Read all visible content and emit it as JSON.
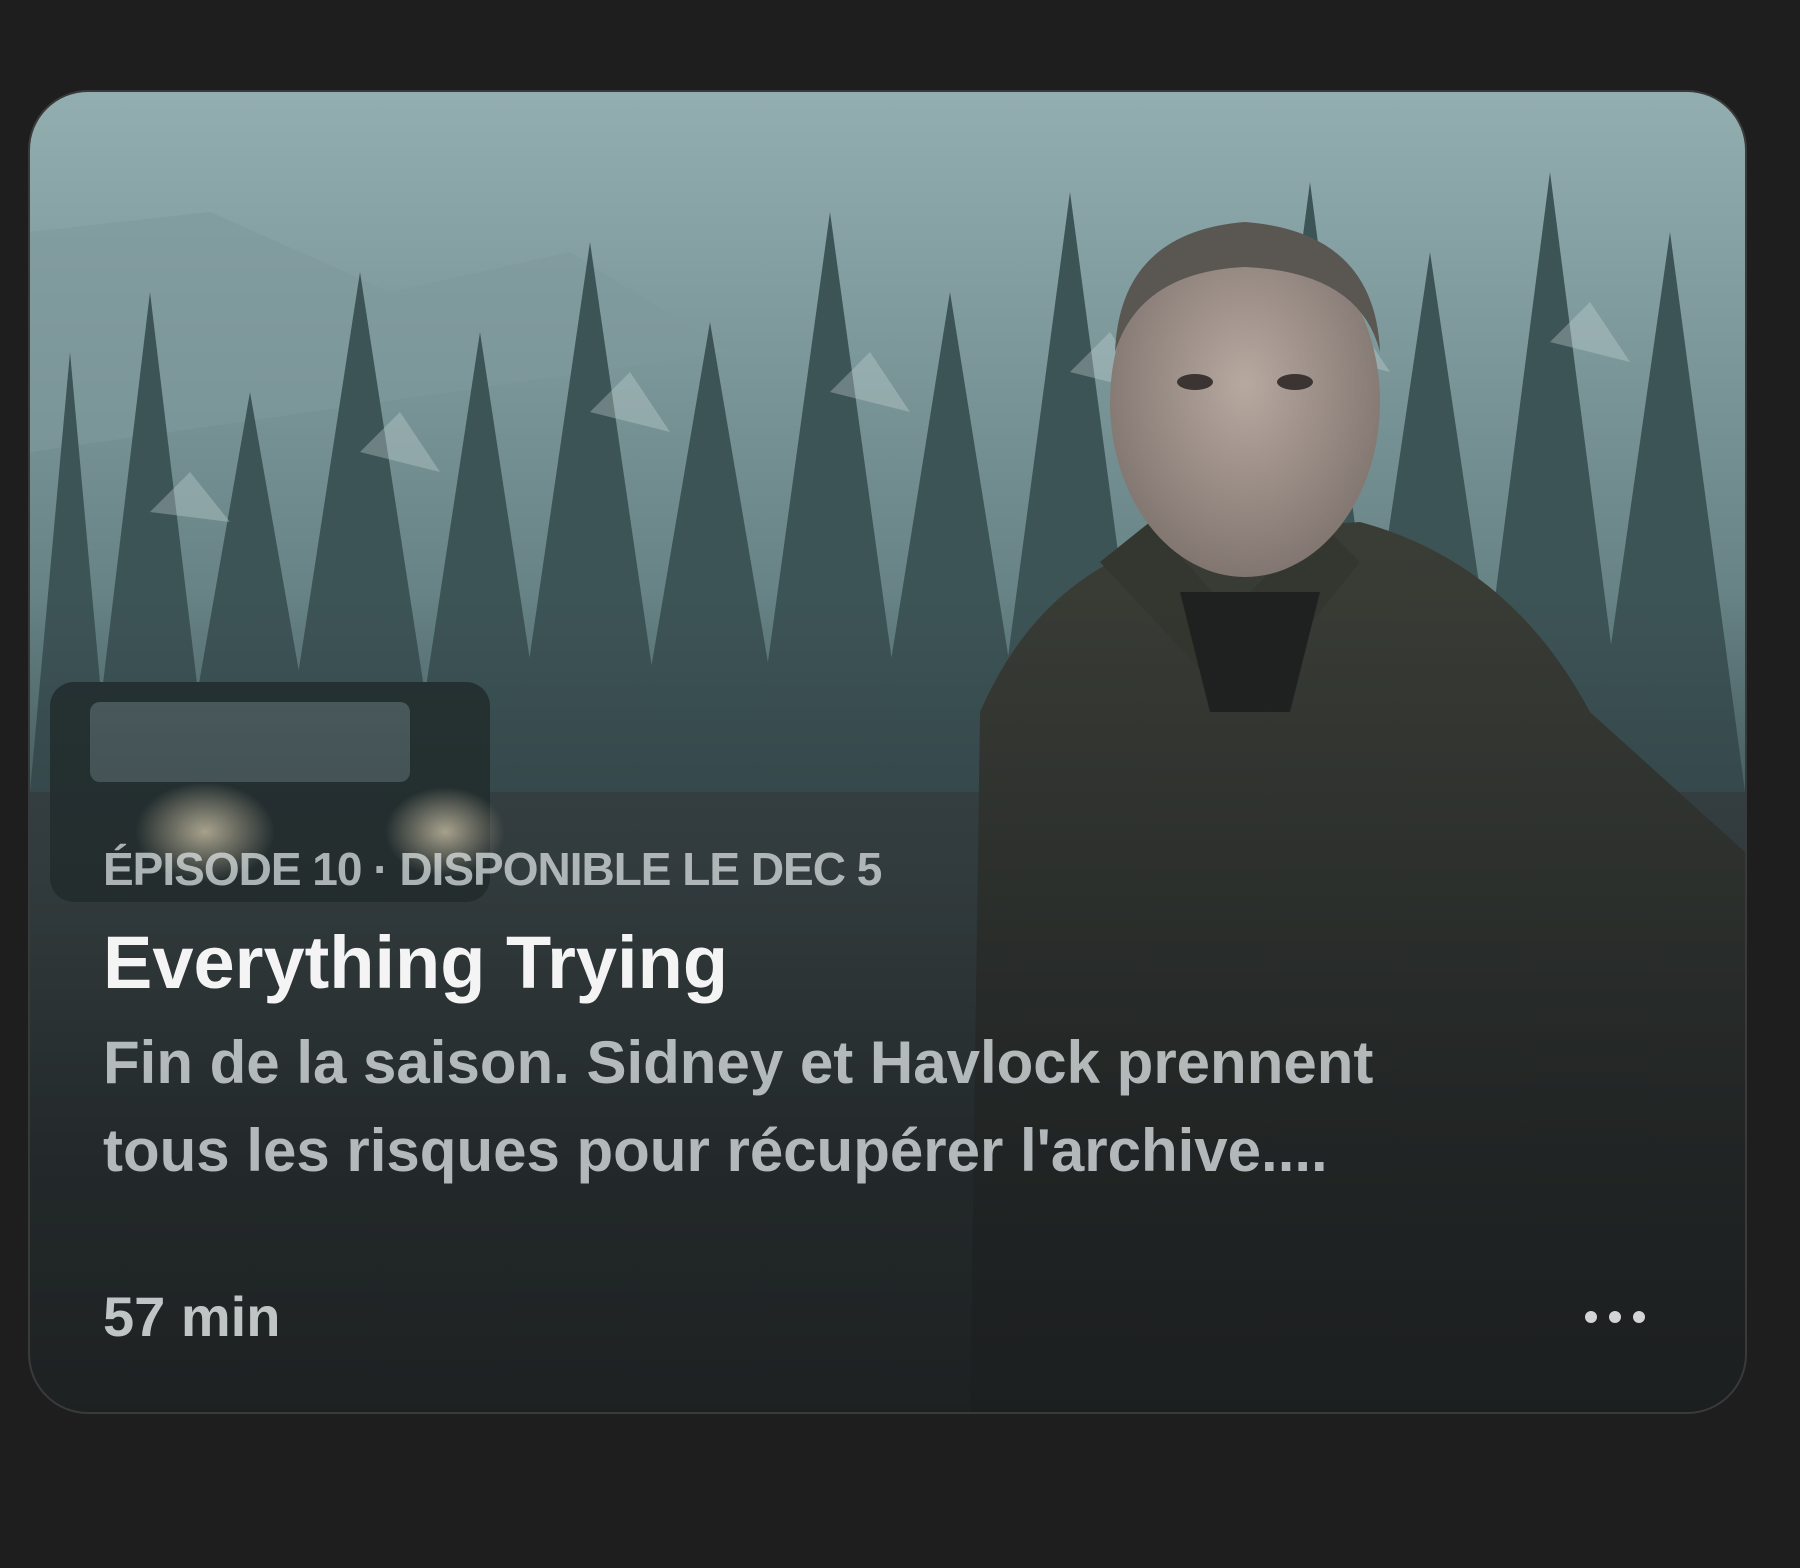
{
  "episode": {
    "eyebrow": "ÉPISODE 10 · DISPONIBLE LE DEC 5",
    "title": "Everything Trying",
    "description_line1": "Fin de la saison. Sidney et Havlock prennent",
    "description_line2": "tous les risques pour récupérer l'archive....",
    "duration": "57 min",
    "more_icon": "ellipsis-icon"
  },
  "colors": {
    "background": "#1e1e1e",
    "title": "#f4f4f4",
    "secondary_text": "#d7dcde"
  }
}
